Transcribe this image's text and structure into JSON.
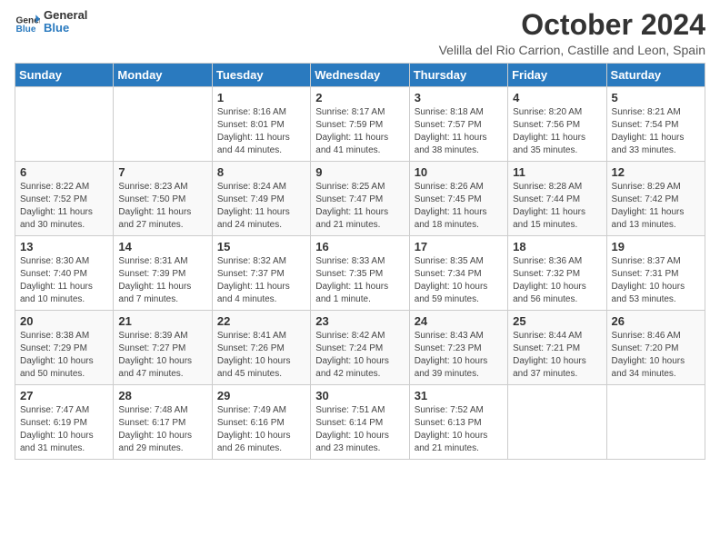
{
  "header": {
    "logo_general": "General",
    "logo_blue": "Blue",
    "month_title": "October 2024",
    "subtitle": "Velilla del Rio Carrion, Castille and Leon, Spain"
  },
  "days_of_week": [
    "Sunday",
    "Monday",
    "Tuesday",
    "Wednesday",
    "Thursday",
    "Friday",
    "Saturday"
  ],
  "weeks": [
    [
      {
        "day": "",
        "info": ""
      },
      {
        "day": "",
        "info": ""
      },
      {
        "day": "1",
        "info": "Sunrise: 8:16 AM\nSunset: 8:01 PM\nDaylight: 11 hours and 44 minutes."
      },
      {
        "day": "2",
        "info": "Sunrise: 8:17 AM\nSunset: 7:59 PM\nDaylight: 11 hours and 41 minutes."
      },
      {
        "day": "3",
        "info": "Sunrise: 8:18 AM\nSunset: 7:57 PM\nDaylight: 11 hours and 38 minutes."
      },
      {
        "day": "4",
        "info": "Sunrise: 8:20 AM\nSunset: 7:56 PM\nDaylight: 11 hours and 35 minutes."
      },
      {
        "day": "5",
        "info": "Sunrise: 8:21 AM\nSunset: 7:54 PM\nDaylight: 11 hours and 33 minutes."
      }
    ],
    [
      {
        "day": "6",
        "info": "Sunrise: 8:22 AM\nSunset: 7:52 PM\nDaylight: 11 hours and 30 minutes."
      },
      {
        "day": "7",
        "info": "Sunrise: 8:23 AM\nSunset: 7:50 PM\nDaylight: 11 hours and 27 minutes."
      },
      {
        "day": "8",
        "info": "Sunrise: 8:24 AM\nSunset: 7:49 PM\nDaylight: 11 hours and 24 minutes."
      },
      {
        "day": "9",
        "info": "Sunrise: 8:25 AM\nSunset: 7:47 PM\nDaylight: 11 hours and 21 minutes."
      },
      {
        "day": "10",
        "info": "Sunrise: 8:26 AM\nSunset: 7:45 PM\nDaylight: 11 hours and 18 minutes."
      },
      {
        "day": "11",
        "info": "Sunrise: 8:28 AM\nSunset: 7:44 PM\nDaylight: 11 hours and 15 minutes."
      },
      {
        "day": "12",
        "info": "Sunrise: 8:29 AM\nSunset: 7:42 PM\nDaylight: 11 hours and 13 minutes."
      }
    ],
    [
      {
        "day": "13",
        "info": "Sunrise: 8:30 AM\nSunset: 7:40 PM\nDaylight: 11 hours and 10 minutes."
      },
      {
        "day": "14",
        "info": "Sunrise: 8:31 AM\nSunset: 7:39 PM\nDaylight: 11 hours and 7 minutes."
      },
      {
        "day": "15",
        "info": "Sunrise: 8:32 AM\nSunset: 7:37 PM\nDaylight: 11 hours and 4 minutes."
      },
      {
        "day": "16",
        "info": "Sunrise: 8:33 AM\nSunset: 7:35 PM\nDaylight: 11 hours and 1 minute."
      },
      {
        "day": "17",
        "info": "Sunrise: 8:35 AM\nSunset: 7:34 PM\nDaylight: 10 hours and 59 minutes."
      },
      {
        "day": "18",
        "info": "Sunrise: 8:36 AM\nSunset: 7:32 PM\nDaylight: 10 hours and 56 minutes."
      },
      {
        "day": "19",
        "info": "Sunrise: 8:37 AM\nSunset: 7:31 PM\nDaylight: 10 hours and 53 minutes."
      }
    ],
    [
      {
        "day": "20",
        "info": "Sunrise: 8:38 AM\nSunset: 7:29 PM\nDaylight: 10 hours and 50 minutes."
      },
      {
        "day": "21",
        "info": "Sunrise: 8:39 AM\nSunset: 7:27 PM\nDaylight: 10 hours and 47 minutes."
      },
      {
        "day": "22",
        "info": "Sunrise: 8:41 AM\nSunset: 7:26 PM\nDaylight: 10 hours and 45 minutes."
      },
      {
        "day": "23",
        "info": "Sunrise: 8:42 AM\nSunset: 7:24 PM\nDaylight: 10 hours and 42 minutes."
      },
      {
        "day": "24",
        "info": "Sunrise: 8:43 AM\nSunset: 7:23 PM\nDaylight: 10 hours and 39 minutes."
      },
      {
        "day": "25",
        "info": "Sunrise: 8:44 AM\nSunset: 7:21 PM\nDaylight: 10 hours and 37 minutes."
      },
      {
        "day": "26",
        "info": "Sunrise: 8:46 AM\nSunset: 7:20 PM\nDaylight: 10 hours and 34 minutes."
      }
    ],
    [
      {
        "day": "27",
        "info": "Sunrise: 7:47 AM\nSunset: 6:19 PM\nDaylight: 10 hours and 31 minutes."
      },
      {
        "day": "28",
        "info": "Sunrise: 7:48 AM\nSunset: 6:17 PM\nDaylight: 10 hours and 29 minutes."
      },
      {
        "day": "29",
        "info": "Sunrise: 7:49 AM\nSunset: 6:16 PM\nDaylight: 10 hours and 26 minutes."
      },
      {
        "day": "30",
        "info": "Sunrise: 7:51 AM\nSunset: 6:14 PM\nDaylight: 10 hours and 23 minutes."
      },
      {
        "day": "31",
        "info": "Sunrise: 7:52 AM\nSunset: 6:13 PM\nDaylight: 10 hours and 21 minutes."
      },
      {
        "day": "",
        "info": ""
      },
      {
        "day": "",
        "info": ""
      }
    ]
  ]
}
